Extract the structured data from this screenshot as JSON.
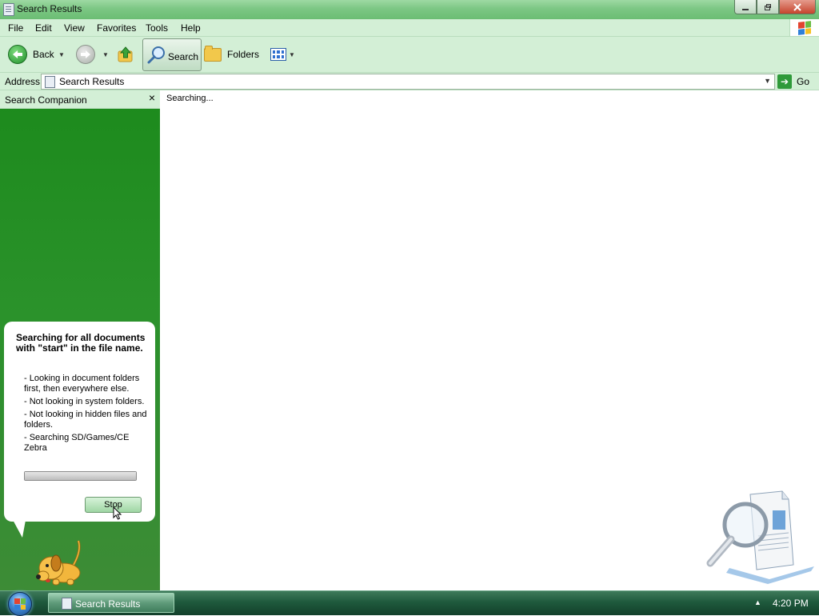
{
  "window": {
    "title": "Search Results"
  },
  "menu": {
    "items": [
      "File",
      "Edit",
      "View",
      "Favorites",
      "Tools",
      "Help"
    ]
  },
  "toolbar": {
    "back_label": "Back",
    "search_label": "Search",
    "folders_label": "Folders"
  },
  "address": {
    "label": "Address",
    "value": "Search Results",
    "go_label": "Go"
  },
  "companion": {
    "title": "Search Companion",
    "close_glyph": "×",
    "heading": "Searching for all documents with \"start\" in the file name.",
    "bullets": [
      "- Looking in document folders first, then everywhere else.",
      "- Not looking in system folders.",
      "- Not looking in hidden files and folders.",
      "- Searching SD/Games/CE Zebra"
    ],
    "stop_label": "Stop"
  },
  "content": {
    "status": "Searching..."
  },
  "taskbar": {
    "task_label": "Search Results",
    "clock": "4:20 PM"
  },
  "colors": {
    "pane_green": "#1c8a1c",
    "chrome_green": "#d3efd6",
    "taskbar_green": "#1f5a3d"
  },
  "icons": [
    "back-arrow-icon",
    "forward-arrow-icon",
    "up-folder-icon",
    "search-magnifier-icon",
    "folders-icon",
    "views-icon",
    "go-arrow-icon",
    "windows-flag-icon",
    "document-icon",
    "search-dog-icon"
  ]
}
